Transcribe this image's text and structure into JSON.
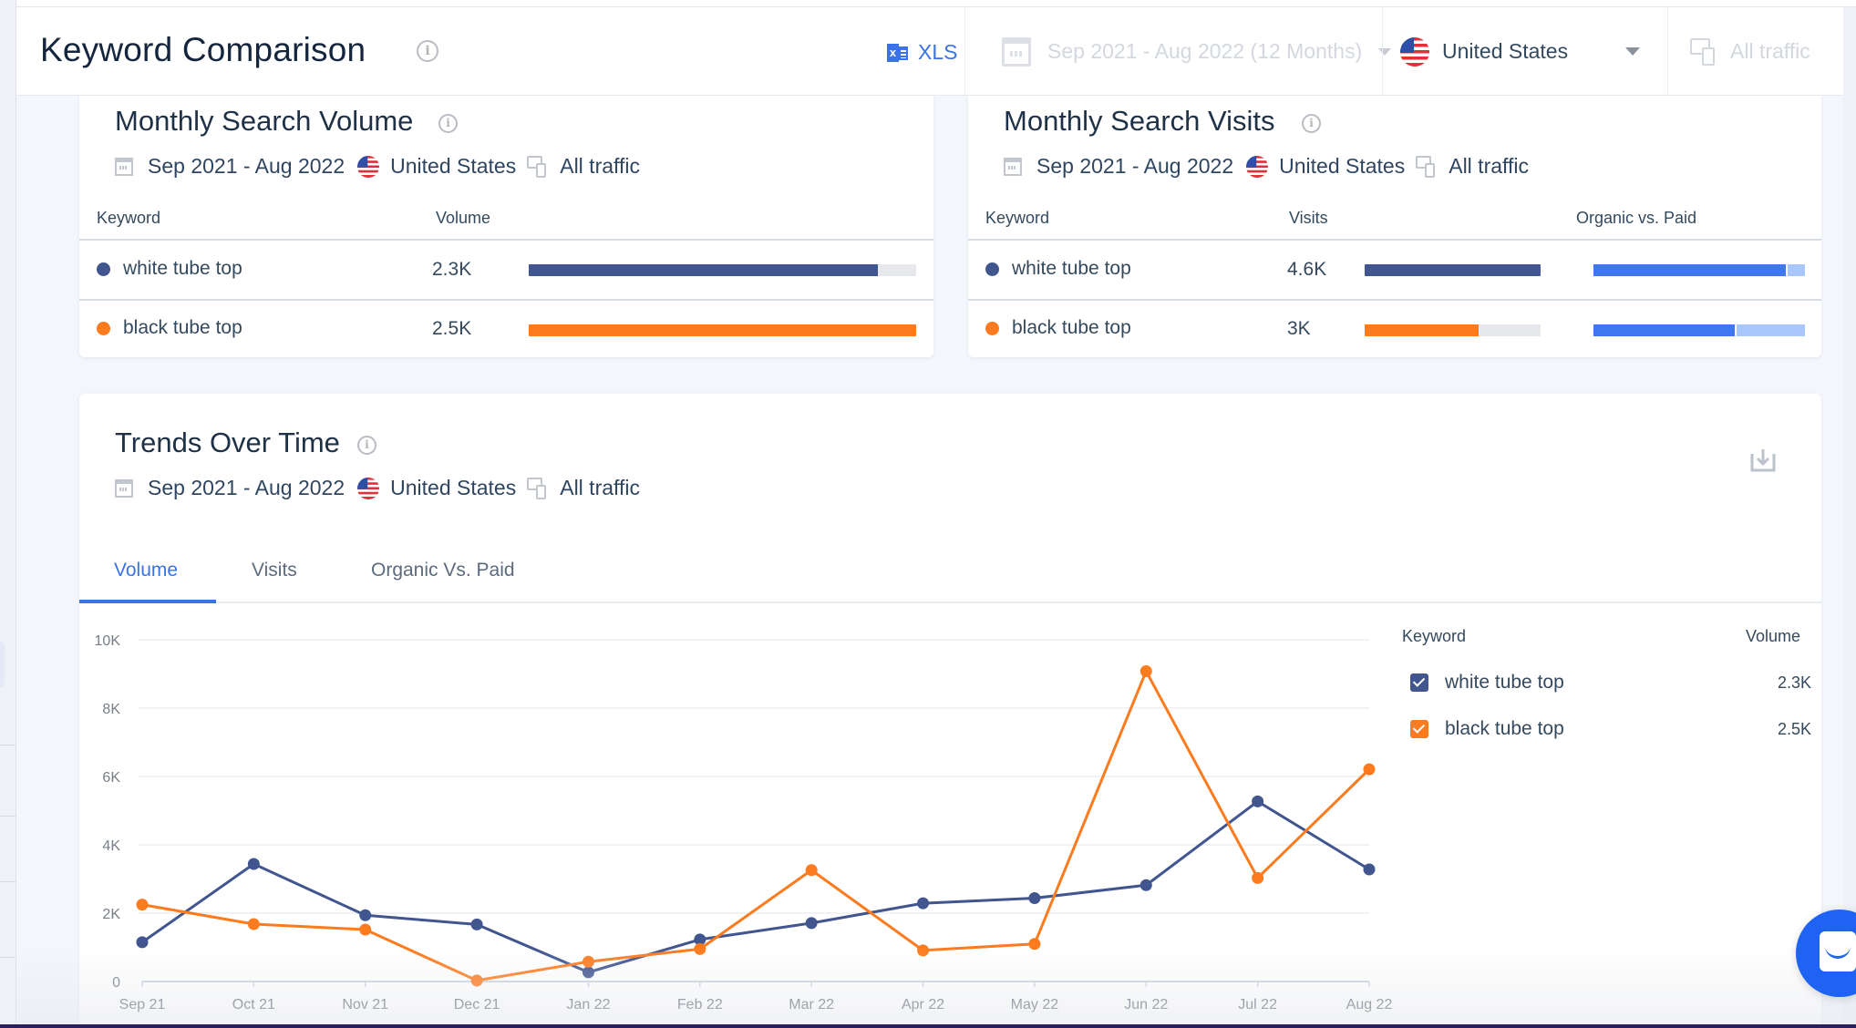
{
  "header": {
    "title": "Keyword Comparison",
    "export_label": "XLS",
    "date_range": "Sep 2021 - Aug 2022 (12 Months)",
    "country": "United States",
    "traffic": "All traffic"
  },
  "colors": {
    "white_tube_top": "#41558f",
    "black_tube_top": "#fd7b1f",
    "accent": "#3a72e8",
    "organic": "#3e77f0",
    "paid": "#a9c7fb"
  },
  "volume_card": {
    "title": "Monthly Search Volume",
    "meta": {
      "date": "Sep 2021 - Aug 2022",
      "country": "United States",
      "traffic": "All traffic"
    },
    "columns": [
      "Keyword",
      "Volume"
    ],
    "rows": [
      {
        "keyword": "white tube top",
        "volume": "2.3K",
        "bar_fraction": 0.9
      },
      {
        "keyword": "black tube top",
        "volume": "2.5K",
        "bar_fraction": 1.0
      }
    ]
  },
  "visits_card": {
    "title": "Monthly Search Visits",
    "meta": {
      "date": "Sep 2021 - Aug 2022",
      "country": "United States",
      "traffic": "All traffic"
    },
    "columns": [
      "Keyword",
      "Visits",
      "Organic vs. Paid"
    ],
    "rows": [
      {
        "keyword": "white tube top",
        "visits": "4.6K",
        "bar_fraction": 1.0,
        "organic_fraction": 0.91
      },
      {
        "keyword": "black tube top",
        "visits": "3K",
        "bar_fraction": 0.65,
        "organic_fraction": 0.67
      }
    ]
  },
  "trends_card": {
    "title": "Trends Over Time",
    "meta": {
      "date": "Sep 2021 - Aug 2022",
      "country": "United States",
      "traffic": "All traffic"
    },
    "tabs": [
      {
        "label": "Volume",
        "active": true
      },
      {
        "label": "Visits",
        "active": false
      },
      {
        "label": "Organic Vs. Paid",
        "active": false
      }
    ],
    "legend": {
      "header_keyword": "Keyword",
      "header_metric": "Volume",
      "items": [
        {
          "keyword": "white tube top",
          "value": "2.3K",
          "checked": true
        },
        {
          "keyword": "black tube top",
          "value": "2.5K",
          "checked": true
        }
      ]
    }
  },
  "chart_data": {
    "type": "line",
    "title": "Trends Over Time",
    "xlabel": "",
    "ylabel": "",
    "x": [
      "Sep 21",
      "Oct 21",
      "Nov 21",
      "Dec 21",
      "Jan 22",
      "Feb 22",
      "Mar 22",
      "Apr 22",
      "May 22",
      "Jun 22",
      "Jul 22",
      "Aug 22"
    ],
    "ylim": [
      0,
      10000
    ],
    "yticks": [
      0,
      2000,
      4000,
      6000,
      8000,
      10000
    ],
    "ytick_labels": [
      "0",
      "2K",
      "4K",
      "6K",
      "8K",
      "10K"
    ],
    "grid": true,
    "legend": "right",
    "series": [
      {
        "name": "white tube top",
        "color": "#41558f",
        "values": [
          1150,
          3440,
          1940,
          1670,
          270,
          1230,
          1710,
          2290,
          2440,
          2820,
          5270,
          3280
        ]
      },
      {
        "name": "black tube top",
        "color": "#fd7b1f",
        "values": [
          2250,
          1680,
          1520,
          30,
          580,
          950,
          3260,
          910,
          1100,
          9080,
          3030,
          6210
        ]
      }
    ]
  }
}
